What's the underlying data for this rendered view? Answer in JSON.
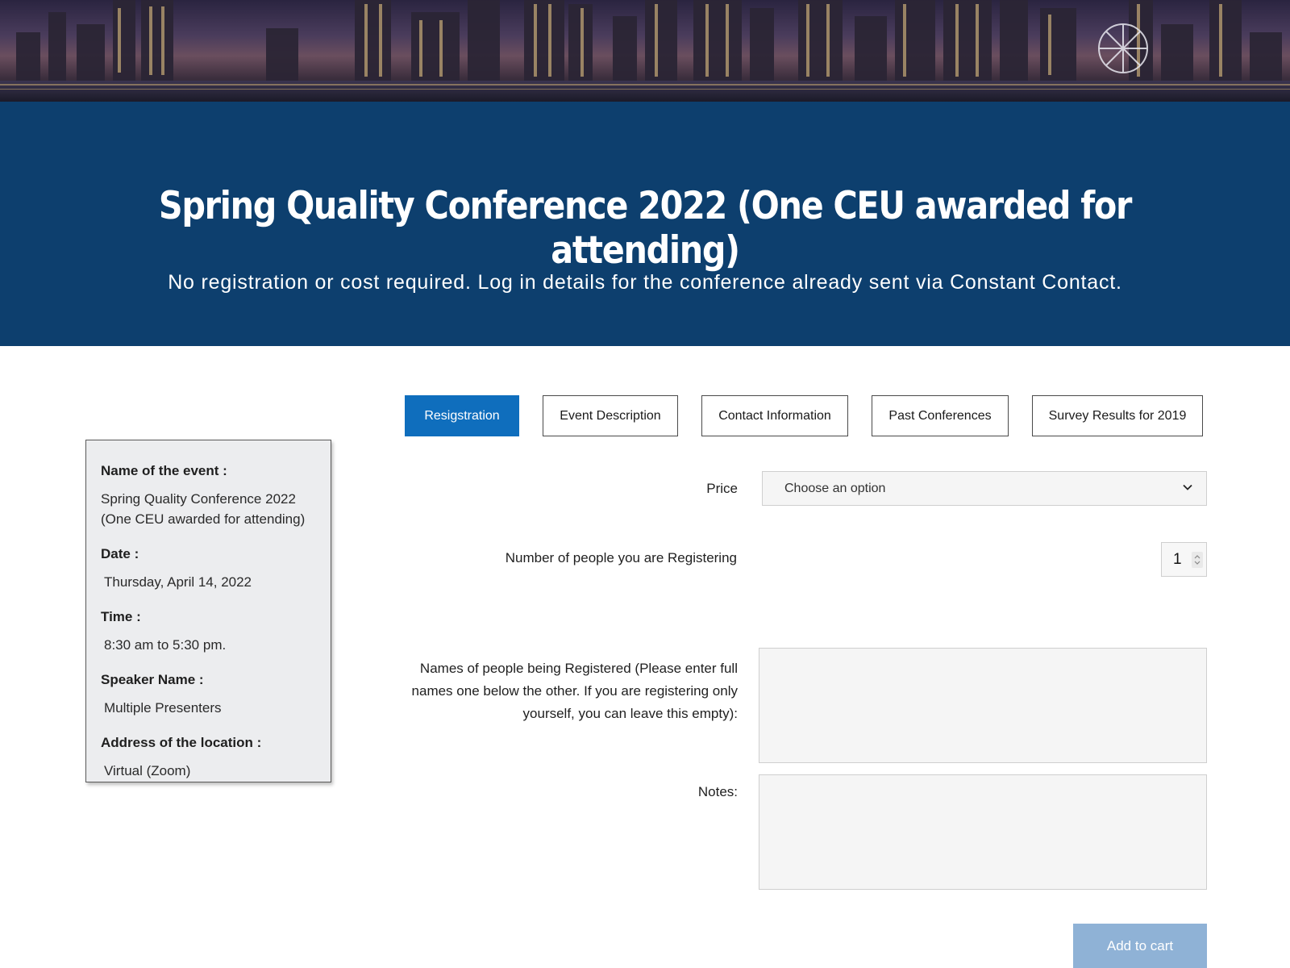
{
  "hero": {
    "title": "Spring Quality Conference 2022 (One CEU awarded for attending)",
    "subtitle": "No registration or cost required. Log in details for the conference already sent via Constant Contact."
  },
  "event_info": {
    "name_label": "Name of the event :",
    "name_value": "Spring Quality Conference 2022 (One CEU awarded for attending)",
    "date_label": "Date :",
    "date_value": "Thursday, April 14, 2022",
    "time_label": "Time :",
    "time_value": "8:30 am to 5:30 pm.",
    "speaker_label": "Speaker Name :",
    "speaker_value": "Multiple Presenters",
    "address_label": "Address of the location :",
    "address_value": "Virtual (Zoom)"
  },
  "tabs": [
    {
      "label": "Resigstration",
      "active": true
    },
    {
      "label": "Event Description",
      "active": false
    },
    {
      "label": "Contact Information",
      "active": false
    },
    {
      "label": "Past Conferences",
      "active": false
    },
    {
      "label": "Survey Results for 2019",
      "active": false
    }
  ],
  "form": {
    "price_label": "Price",
    "price_value": "Choose an option",
    "people_label": "Number of people you are Registering",
    "people_value": "1",
    "names_label": "Names of people being Registered (Please enter full names one below the other. If you are registering only yourself, you can leave this empty):",
    "names_value": "",
    "notes_label": "Notes:",
    "notes_value": "",
    "submit_label": "Add to cart"
  },
  "colors": {
    "hero_background": "#0d3f6e",
    "active_tab": "#0f6ebd",
    "button_disabled": "#8fb2d6"
  }
}
